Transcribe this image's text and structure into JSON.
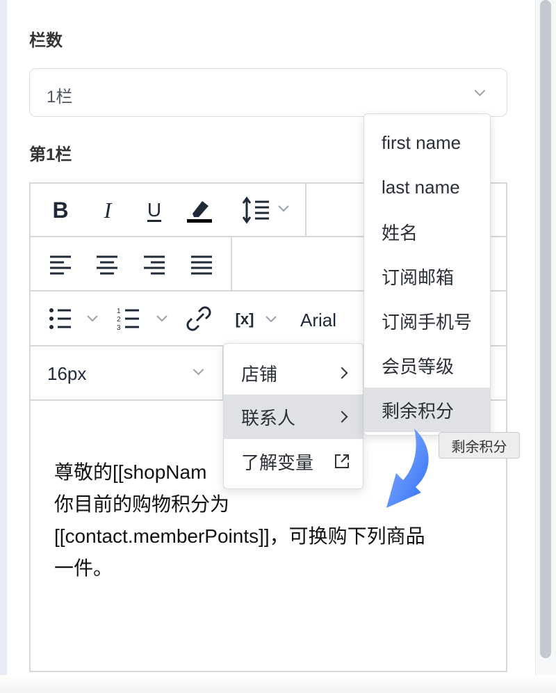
{
  "columns": {
    "label": "栏数",
    "selected": "1栏",
    "column_label": "第1栏"
  },
  "toolbar": {
    "bold": "B",
    "italic": "I",
    "underline": "U",
    "variable_icon_text": "[x]",
    "font_family": "Arial",
    "font_size": "16px"
  },
  "content": {
    "line1": "尊敬的[[shopNam",
    "line2": "你目前的购物积分为",
    "line3": "[[contact.memberPoints]]，可换购下列商品",
    "line4": "一件。"
  },
  "variable_menu": {
    "items": [
      "店铺",
      "联系人",
      "了解变量"
    ]
  },
  "contact_submenu": {
    "items": [
      "first name",
      "last name",
      "姓名",
      "订阅邮箱",
      "订阅手机号",
      "会员等级",
      "剩余积分"
    ]
  },
  "tooltip": "剩余积分",
  "colors": {
    "highlight_bg": "#dfe1e5",
    "arrow_blue": "#2f6ff7"
  }
}
